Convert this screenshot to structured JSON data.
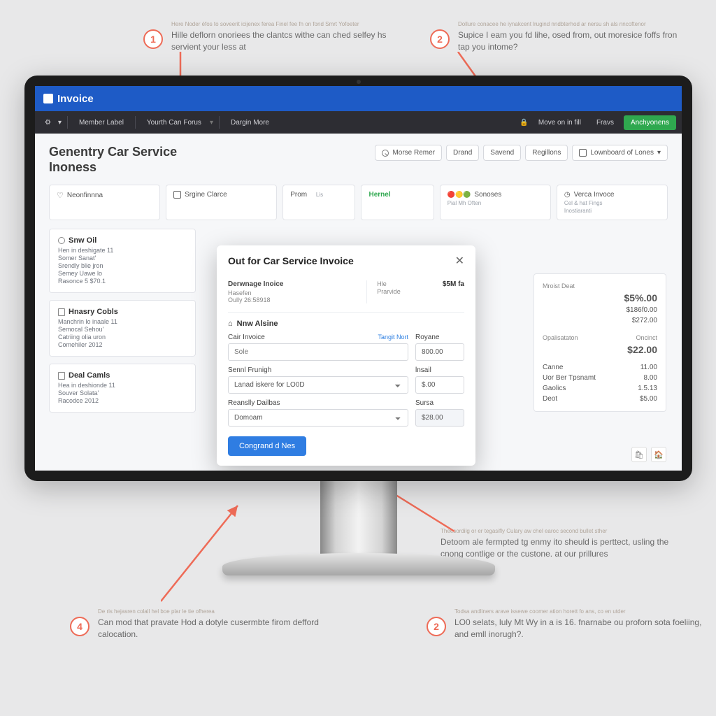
{
  "topbar": {
    "brand": "Invoice"
  },
  "menubar": {
    "items": [
      "Member Label",
      "Yourth Can Forus",
      "Dargin More"
    ],
    "right_link": "Move on in fill",
    "right_text": "Fravs",
    "cta": "Anchyonens"
  },
  "page": {
    "title_line1": "Genentry Car Service",
    "title_line2": "Inoness"
  },
  "actions": {
    "search_placeholder": "Morse Remer",
    "btn1": "Drand",
    "btn2": "Savend",
    "btn3": "Regillons",
    "dropdown": "Lownboard of Lones"
  },
  "tabs": [
    {
      "icon": "heart",
      "label": "Neonfinnna"
    },
    {
      "icon": "box",
      "label": "Srgine Clarce"
    },
    {
      "label": "Prom",
      "sub": "Lis"
    },
    {
      "label": "Hernel",
      "green": true
    },
    {
      "icon": "multi",
      "label": "Sonoses",
      "sub": "Pial Mh Often"
    },
    {
      "icon": "clock",
      "label": "Verca Invoce",
      "sub": "Cel & hat Fings",
      "sub2": "Inostiaranti"
    }
  ],
  "left_cards": [
    {
      "title": "Snw Oil",
      "lines": [
        "Hen in deshigate 11",
        "Somer Sanat'",
        "Srendly blie jron",
        "Semey Uawe lo",
        "Rasonce 5 $70.1"
      ]
    },
    {
      "title": "Hnasry Cobls",
      "lines": [
        "Manchrin lo inaale 11",
        "Semocal Sehou'",
        "Catriing olia uron",
        "Comehiler 2012"
      ]
    },
    {
      "title": "Deal Camls",
      "lines": [
        "Hea in deshionde 11",
        "Souver Solata'",
        "Racodce 2012"
      ]
    }
  ],
  "right_block": {
    "h1": "Mroist Deat",
    "v1": "$5%.00",
    "r2": "$186f0.00",
    "r3": "$272.00",
    "h4": "Opalisataton",
    "v4": "$22.00",
    "h5": "Oncinct",
    "rows": [
      {
        "l": "Canne",
        "v": "11.00"
      },
      {
        "l": "Uor Ber Tpsnamt",
        "v": "8.00"
      },
      {
        "l": "Gaolics",
        "v": "1.5.13"
      },
      {
        "l": "Deot",
        "v": "$5.00"
      }
    ]
  },
  "modal": {
    "title": "Out for Car Service Invoice",
    "top": {
      "l1": "Derwnage Inoice",
      "l2": "Hasefen",
      "l3": "Oully 26:58918",
      "r1": "Hle",
      "r2": "Prarvide",
      "rv": "$5M fa"
    },
    "section": "Nnw Alsine",
    "f1_label": "Cair Invoice",
    "f1_link": "Tangit Nort",
    "f1_placeholder": "Sole",
    "f2_label": "Sennl Frunigh",
    "f2_placeholder": "Lanad iskere for LO0D",
    "f3_label": "Reanslly Dailbas",
    "f3_placeholder": "Domoam",
    "a1_label": "Royane",
    "a1_val": "800.00",
    "a2_label": "lnsail",
    "a2_val": "$.00",
    "a3_label": "Sursa",
    "a3_val": "$28.00",
    "submit": "Congrand d Nes"
  },
  "callouts": {
    "c1_sub": "Here Noder éfos to soveerit icijenex ferea Finel fee fn on fond Smrt Yofoeter",
    "c1": "Hille deflorn onoriees the clantcs withe can ched selfey hs servient your less at",
    "c2_sub": "Dollure conacee he iynakcent lrugind nndbterhod ar nersu sh als nncoftenor",
    "c2": "Supice I eam you fd lihe, osed from, out moresice foffs fron tap you intome?",
    "c3_sub": "Theesordilg or er tegasifly Culary aw chel earoc second bullet sther",
    "c3": "Detoom ale fermpted tg enmy ito sheuld is perttect, usling the cnong contlige or the custone. at our prillures",
    "c3a_sub": "Todsa andliners arave issewe coomer ation horett fo ans, co en utder",
    "c3a": "LO0 selats, luly Mt Wy in a is 16. fnarnabe ou proforn sota foeliing, and emll inorugh?.",
    "c4_sub": "De ris hejasren colall hel boe plar le tie ofherea",
    "c4": "Can mod that pravate Hod a dotyle cusermbte firom defford calocation."
  }
}
